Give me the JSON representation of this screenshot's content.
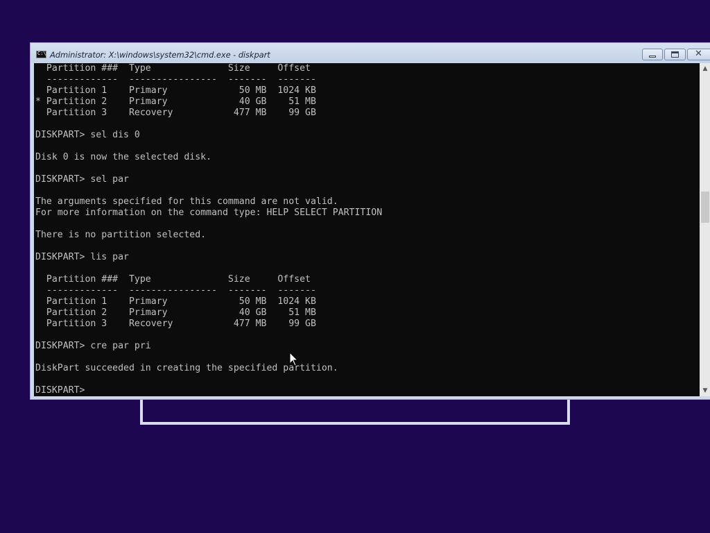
{
  "window": {
    "title": "Administrator: X:\\windows\\system32\\cmd.exe - diskpart",
    "icon": "cmd-icon",
    "icon_label": "C:\\",
    "controls": {
      "minimize": "minimize-icon",
      "maximize": "maximize-icon",
      "close": "close-icon",
      "close_glyph": "✕"
    }
  },
  "console": {
    "lines": [
      "  Partition ###  Type              Size     Offset",
      "  -------------  ----------------  -------  -------",
      "  Partition 1    Primary             50 MB  1024 KB",
      "* Partition 2    Primary             40 GB    51 MB",
      "  Partition 3    Recovery           477 MB    99 GB",
      "",
      "DISKPART> sel dis 0",
      "",
      "Disk 0 is now the selected disk.",
      "",
      "DISKPART> sel par",
      "",
      "The arguments specified for this command are not valid.",
      "For more information on the command type: HELP SELECT PARTITION",
      "",
      "There is no partition selected.",
      "",
      "DISKPART> lis par",
      "",
      "  Partition ###  Type              Size     Offset",
      "  -------------  ----------------  -------  -------",
      "  Partition 1    Primary             50 MB  1024 KB",
      "  Partition 2    Primary             40 GB    51 MB",
      "  Partition 3    Recovery           477 MB    99 GB",
      "",
      "DISKPART> cre par pri",
      "",
      "DiskPart succeeded in creating the specified partition.",
      "",
      "DISKPART> "
    ]
  },
  "scrollbar": {
    "up_glyph": "▲",
    "down_glyph": "▼"
  },
  "colors": {
    "desktop": "#1e0751",
    "console_bg": "#0c0c0c",
    "console_fg": "#c0c0c0"
  }
}
